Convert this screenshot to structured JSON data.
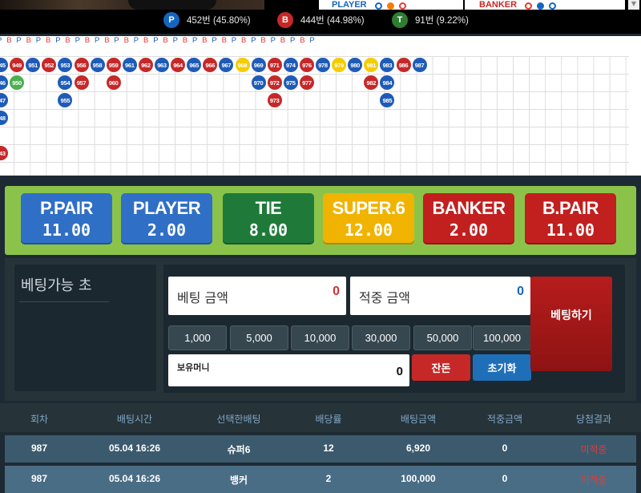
{
  "stats": [
    {
      "badge": "P",
      "text": "452번 (45.80%)",
      "color": "#1565c0"
    },
    {
      "badge": "B",
      "text": "444번 (44.98%)",
      "color": "#c62828"
    },
    {
      "badge": "T",
      "text": "91번 (9.22%)",
      "color": "#2e7d32"
    }
  ],
  "predict": {
    "player": "PLAYER",
    "banker": "BANKER"
  },
  "road": {
    "header": [
      "P",
      "B",
      "P",
      "B",
      "P",
      "B",
      "P",
      "B",
      "P",
      "B",
      "P",
      "B",
      "P",
      "B",
      "P",
      "B",
      "P",
      "B",
      "P",
      "B",
      "P",
      "B",
      "P",
      "B",
      "P",
      "B",
      "P",
      "B",
      "P",
      "B",
      "P",
      "B",
      "P"
    ],
    "columns": [
      [
        {
          "n": "945",
          "c": "P"
        },
        {
          "n": "946",
          "c": "P"
        },
        {
          "n": "947",
          "c": "P"
        },
        {
          "n": "948",
          "c": "P"
        },
        {
          "n": "",
          "c": "E"
        },
        {
          "n": "943",
          "c": "B"
        }
      ],
      [
        {
          "n": "949",
          "c": "B"
        },
        {
          "n": "950",
          "c": "T"
        }
      ],
      [
        {
          "n": "951",
          "c": "P"
        }
      ],
      [
        {
          "n": "952",
          "c": "B"
        }
      ],
      [
        {
          "n": "953",
          "c": "P"
        },
        {
          "n": "954",
          "c": "P"
        },
        {
          "n": "955",
          "c": "P"
        }
      ],
      [
        {
          "n": "956",
          "c": "B"
        },
        {
          "n": "957",
          "c": "B"
        }
      ],
      [
        {
          "n": "958",
          "c": "P"
        }
      ],
      [
        {
          "n": "959",
          "c": "B"
        },
        {
          "n": "960",
          "c": "B"
        }
      ],
      [
        {
          "n": "961",
          "c": "P"
        }
      ],
      [
        {
          "n": "962",
          "c": "B"
        }
      ],
      [
        {
          "n": "963",
          "c": "P"
        }
      ],
      [
        {
          "n": "964",
          "c": "B"
        }
      ],
      [
        {
          "n": "965",
          "c": "P"
        }
      ],
      [
        {
          "n": "966",
          "c": "B"
        }
      ],
      [
        {
          "n": "967",
          "c": "P"
        }
      ],
      [
        {
          "n": "968",
          "c": "S"
        }
      ],
      [
        {
          "n": "969",
          "c": "P"
        },
        {
          "n": "970",
          "c": "P"
        }
      ],
      [
        {
          "n": "971",
          "c": "B"
        },
        {
          "n": "972",
          "c": "B"
        },
        {
          "n": "973",
          "c": "B"
        }
      ],
      [
        {
          "n": "974",
          "c": "P"
        },
        {
          "n": "975",
          "c": "P"
        }
      ],
      [
        {
          "n": "976",
          "c": "B"
        },
        {
          "n": "977",
          "c": "B"
        }
      ],
      [
        {
          "n": "978",
          "c": "P"
        }
      ],
      [
        {
          "n": "979",
          "c": "S"
        }
      ],
      [
        {
          "n": "980",
          "c": "P"
        }
      ],
      [
        {
          "n": "981",
          "c": "S"
        },
        {
          "n": "982",
          "c": "B"
        }
      ],
      [
        {
          "n": "983",
          "c": "P"
        },
        {
          "n": "984",
          "c": "P"
        },
        {
          "n": "985",
          "c": "P"
        }
      ],
      [
        {
          "n": "986",
          "c": "B"
        }
      ],
      [
        {
          "n": "987",
          "c": "P"
        }
      ]
    ]
  },
  "bets": [
    {
      "name": "P.PAIR",
      "odds": "11.00",
      "color": "#2f6fc6"
    },
    {
      "name": "PLAYER",
      "odds": "2.00",
      "color": "#2f6fc6"
    },
    {
      "name": "TIE",
      "odds": "8.00",
      "color": "#1f7a3a"
    },
    {
      "name": "SUPER.6",
      "odds": "12.00",
      "color": "#f0b400"
    },
    {
      "name": "BANKER",
      "odds": "2.00",
      "color": "#c21f1f"
    },
    {
      "name": "B.PAIR",
      "odds": "11.00",
      "color": "#c21f1f"
    }
  ],
  "betting": {
    "seconds_label": "베팅가능 초",
    "bet_amount_label": "베팅 금액",
    "bet_amount": "0",
    "win_amount_label": "적중 금액",
    "win_amount": "0",
    "chips": [
      "1,000",
      "5,000",
      "10,000",
      "30,000",
      "50,000",
      "100,000"
    ],
    "balance_label": "보유머니",
    "balance": "0",
    "change_label": "잔돈",
    "reset_label": "초기화",
    "place_label": "베팅하기"
  },
  "table": {
    "headers": [
      "회차",
      "배팅시간",
      "선택한배팅",
      "배당률",
      "배팅금액",
      "적중금액",
      "당첨결과"
    ],
    "rows": [
      [
        "987",
        "05.04 16:26",
        "슈퍼6",
        "12",
        "6,920",
        "0",
        "미적중"
      ],
      [
        "987",
        "05.04 16:26",
        "뱅커",
        "2",
        "100,000",
        "0",
        "미적중"
      ]
    ]
  }
}
